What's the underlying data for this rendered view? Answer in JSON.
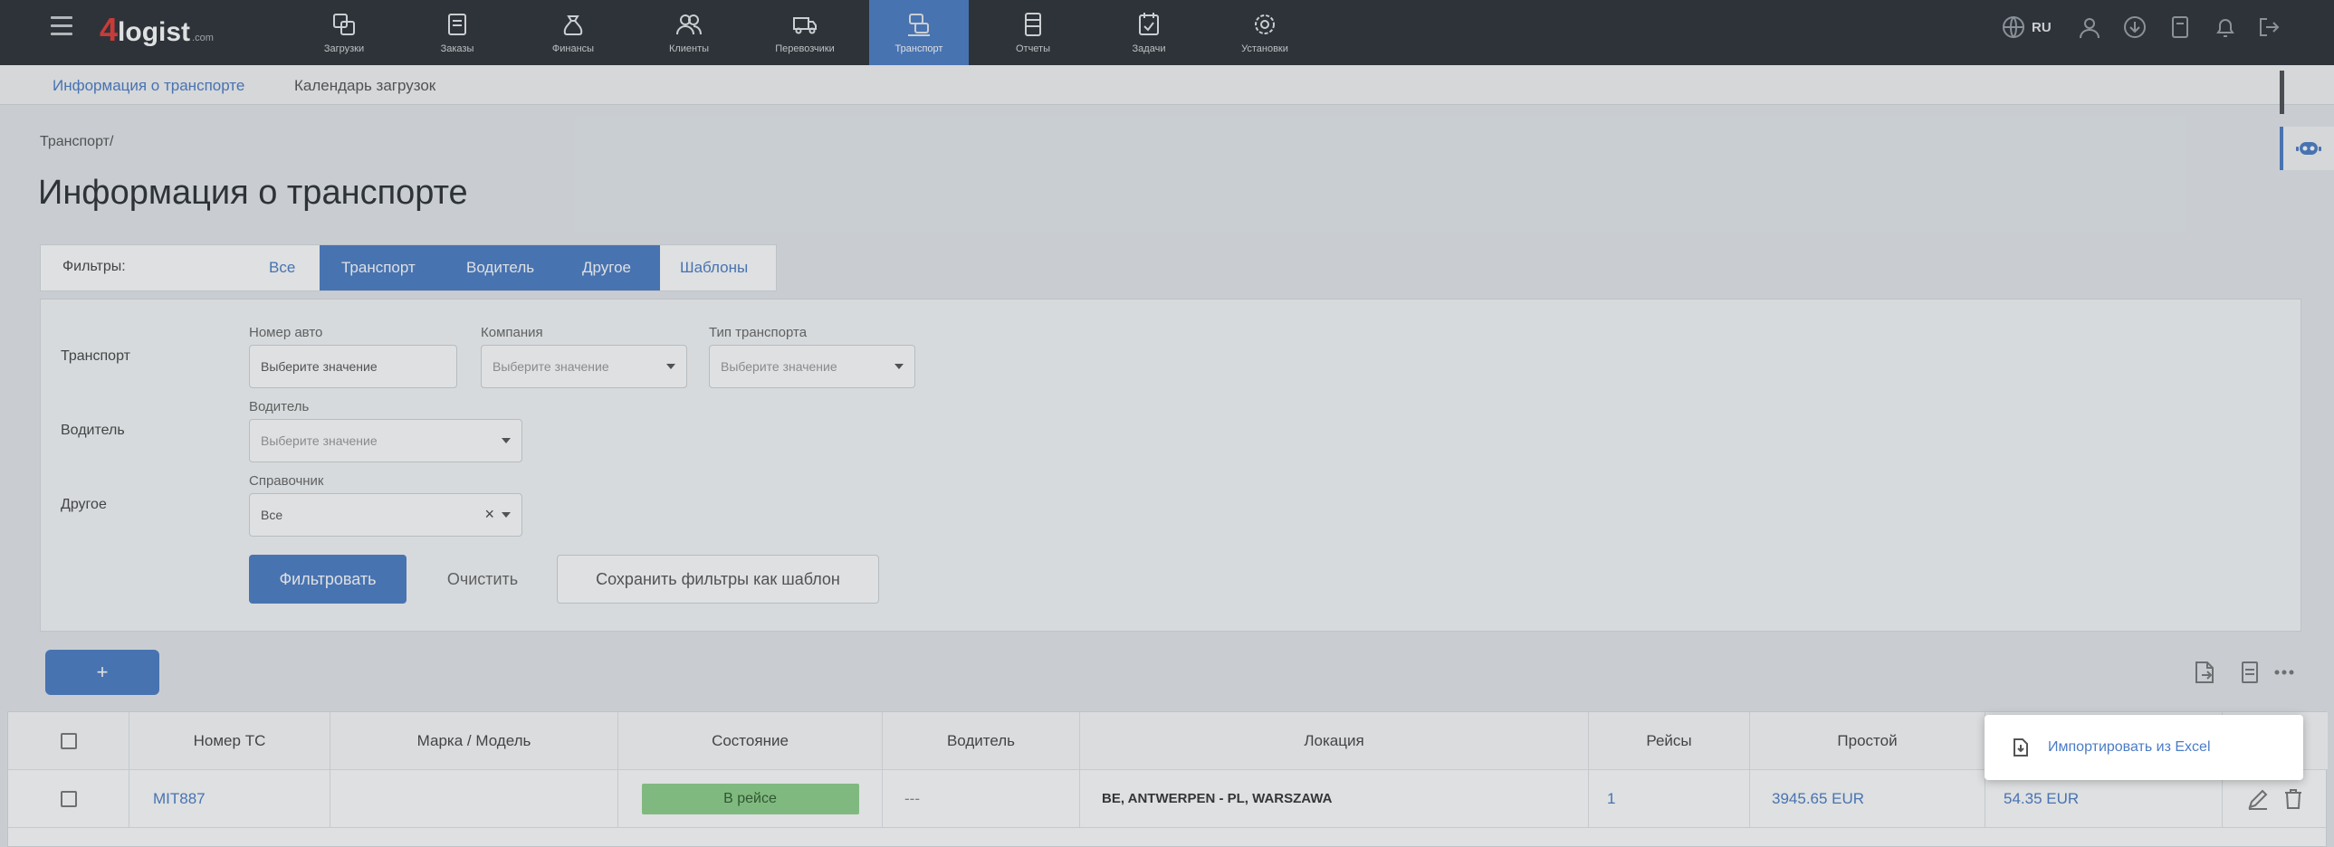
{
  "app": {
    "logo_four": "4",
    "logo_name": "logist",
    "logo_suffix": ".com"
  },
  "nav": [
    {
      "label": "Загрузки",
      "icon": "loads-icon"
    },
    {
      "label": "Заказы",
      "icon": "orders-icon"
    },
    {
      "label": "Финансы",
      "icon": "finance-icon"
    },
    {
      "label": "Клиенты",
      "icon": "clients-icon"
    },
    {
      "label": "Перевозчики",
      "icon": "carriers-icon"
    },
    {
      "label": "Транспорт",
      "icon": "transport-icon",
      "active": true
    },
    {
      "label": "Отчеты",
      "icon": "reports-icon"
    },
    {
      "label": "Задачи",
      "icon": "tasks-icon"
    },
    {
      "label": "Установки",
      "icon": "settings-icon"
    }
  ],
  "topright": {
    "lang": "RU"
  },
  "subnav": {
    "info": "Информация о транспорте",
    "calendar": "Календарь загрузок"
  },
  "breadcrumb": "Транспорт/",
  "page_title": "Информация о транспорте",
  "filter_tabs": {
    "label": "Фильтры:",
    "all": "Все",
    "transport": "Транспорт",
    "driver": "Водитель",
    "other": "Другое",
    "templates": "Шаблоны"
  },
  "filters": {
    "row_transport": "Транспорт",
    "row_driver": "Водитель",
    "row_other": "Другое",
    "plate_label": "Номер авто",
    "plate_placeholder": "Выберите значение",
    "company_label": "Компания",
    "company_placeholder": "Выберите значение",
    "type_label": "Тип транспорта",
    "type_placeholder": "Выберите значение",
    "driver_label": "Водитель",
    "driver_placeholder": "Выберите значение",
    "ref_label": "Справочник",
    "ref_value": "Все",
    "filter_btn": "Фильтровать",
    "clear_btn": "Очистить",
    "save_btn": "Сохранить фильтры как шаблон"
  },
  "add_btn": "+",
  "table": {
    "headers": [
      "Номер ТС",
      "Марка / Модель",
      "Состояние",
      "Водитель",
      "Локация",
      "Рейсы",
      "Простой"
    ],
    "row": {
      "plate": "MIT887",
      "model": "",
      "status": "В рейсе",
      "driver": "---",
      "location": "BE, ANTWERPEN - PL, WARSZAWA",
      "trips": "1",
      "idle": "3945.65 EUR",
      "extra": "54.35 EUR"
    }
  },
  "menu": {
    "import_excel": "Импортировать из Excel"
  }
}
